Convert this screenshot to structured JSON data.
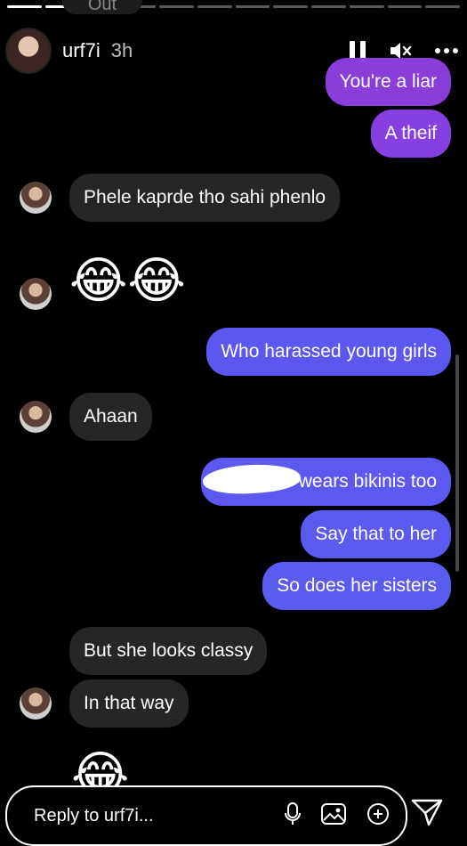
{
  "story": {
    "username": "urf7i",
    "time": "3h",
    "progress_segments": 12,
    "progress_done": 2
  },
  "top_cut_text": "Out",
  "messages": [
    {
      "side": "out",
      "text": "You're a liar",
      "color": "#8a3ed9"
    },
    {
      "side": "out",
      "text": "A theif",
      "color": "#8640e1"
    },
    {
      "side": "in",
      "text": "Phele kaprde tho sahi phenlo"
    },
    {
      "side": "in",
      "emoji": "😂😂"
    },
    {
      "side": "out",
      "text": "Who harassed young girls",
      "color": "#5b57ef"
    },
    {
      "side": "in",
      "text": "Ahaan"
    },
    {
      "side": "out",
      "text": "wears bikinis too",
      "color": "#5d58f1"
    },
    {
      "side": "out",
      "text": "Say that to her",
      "color": "#5b5bf1"
    },
    {
      "side": "out",
      "text": "So does her sisters",
      "color": "#5a5cf0"
    },
    {
      "side": "in",
      "text": "But she looks classy"
    },
    {
      "side": "in",
      "text": "In that way"
    },
    {
      "side": "in",
      "emoji": "😂"
    }
  ],
  "reply": {
    "placeholder": "Reply to urf7i..."
  },
  "icons": {
    "pause": "pause-icon",
    "mute": "mute-icon",
    "more": "more-icon",
    "mic": "mic-icon",
    "gallery": "gallery-icon",
    "sticker": "sticker-icon",
    "send": "send-icon"
  }
}
